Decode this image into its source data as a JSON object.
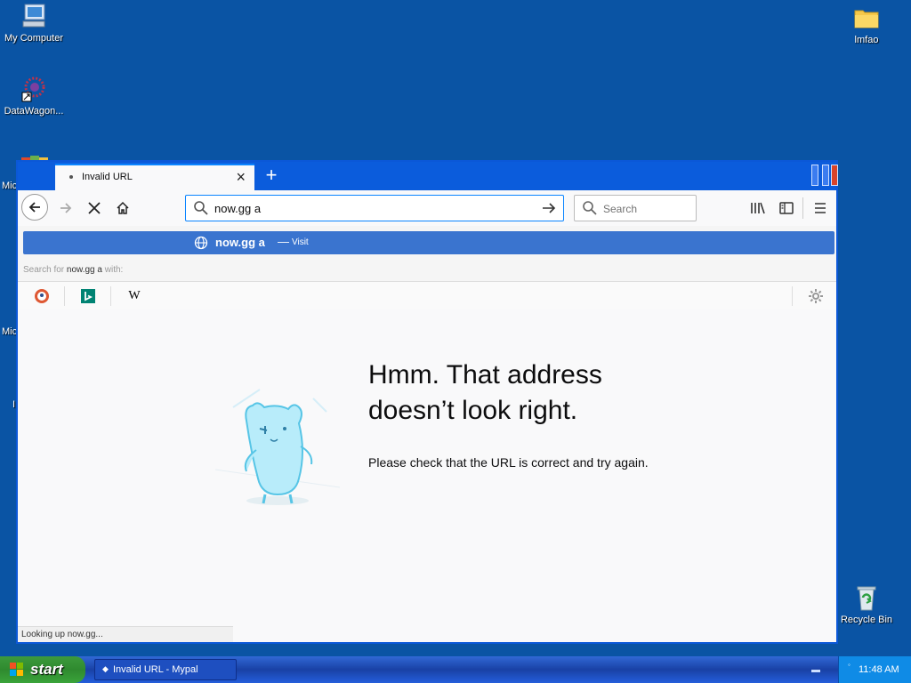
{
  "desktop": {
    "icons": [
      {
        "label": "My Computer"
      },
      {
        "label": "DataWagon..."
      },
      {
        "label": "lmfao"
      },
      {
        "label": "Recycle Bin"
      }
    ],
    "partial_labels": [
      "Mic",
      "Mic",
      "I"
    ]
  },
  "browser": {
    "tab": {
      "title": "Invalid URL"
    },
    "url": {
      "value": "now.gg a"
    },
    "search": {
      "placeholder": "Search"
    },
    "suggestion": {
      "query": "now.gg a",
      "separator": "—",
      "action": "Visit"
    },
    "search_for": {
      "prefix": "Search for",
      "query": "now.gg a",
      "suffix": "with:"
    },
    "engines": [
      "duckduckgo-icon",
      "bing-icon",
      "wikipedia-icon"
    ],
    "error": {
      "title_line1": "Hmm. That address",
      "title_line2": "doesn’t look right.",
      "description": "Please check that the URL is correct and try again."
    },
    "status": "Looking up now.gg..."
  },
  "taskbar": {
    "start_label": "start",
    "task_button": "Invalid URL - Mypal",
    "time": "11:48 AM"
  },
  "colors": {
    "desktop": "#0a54a4",
    "accent": "#0a84ff",
    "suggestion_bg": "#3a74cf"
  }
}
